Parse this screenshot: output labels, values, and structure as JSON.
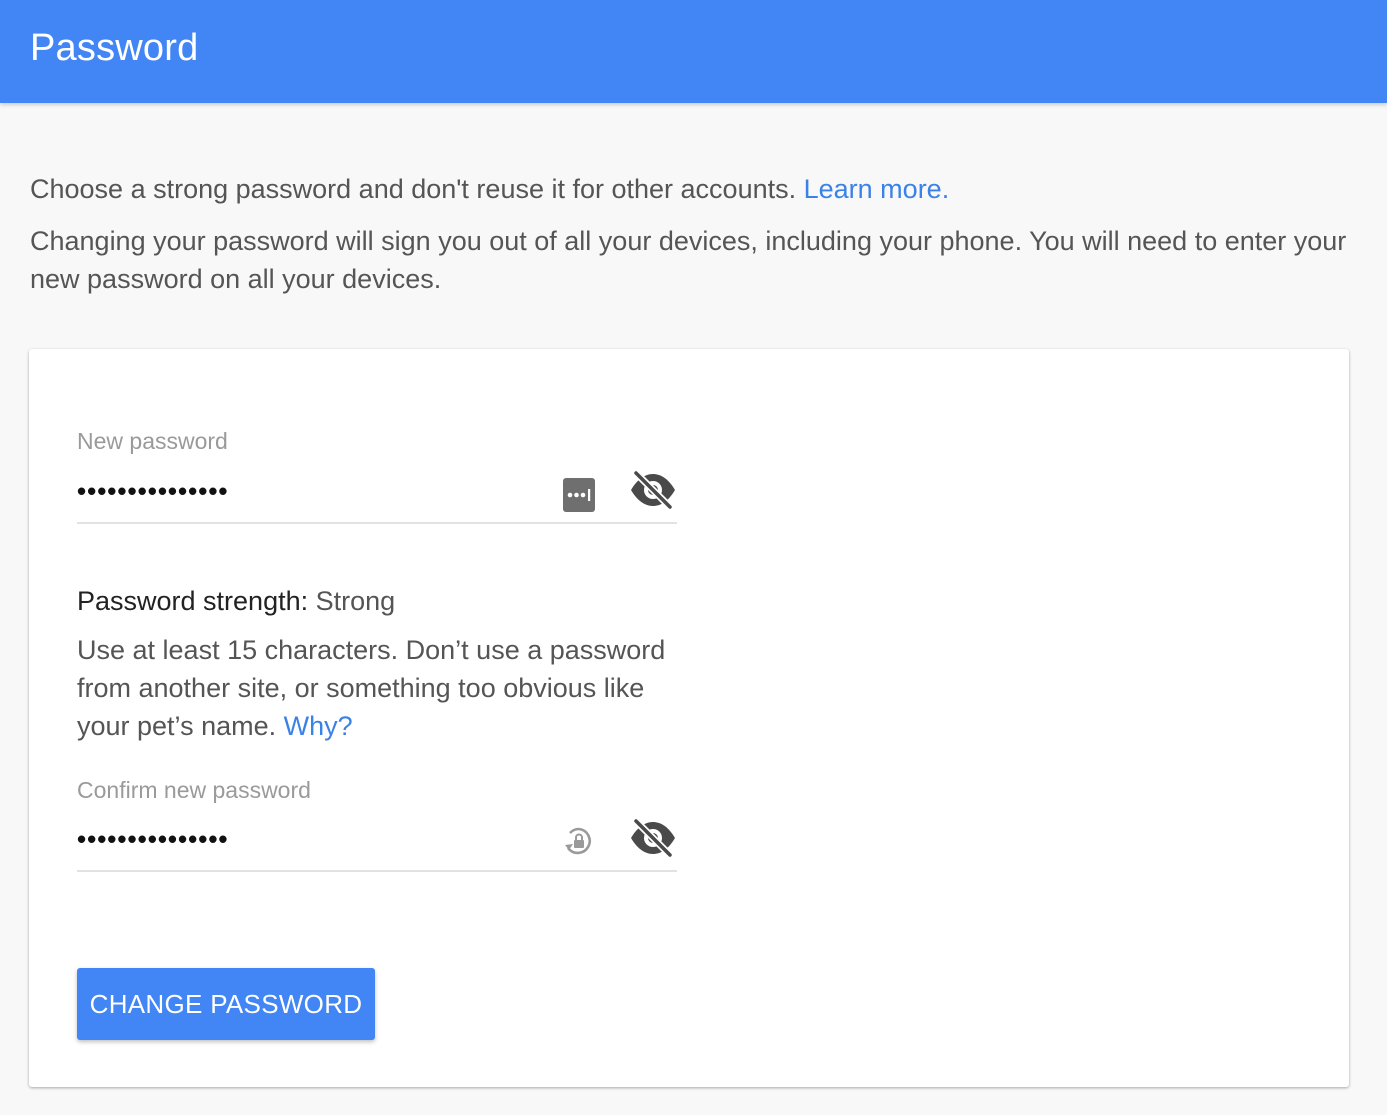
{
  "header": {
    "title": "Password"
  },
  "intro": {
    "line1": "Choose a strong password and don't reuse it for other accounts.",
    "learn_more": "Learn more.",
    "line2": "Changing your password will sign you out of all your devices, including your phone. You will need to enter your new password on all your devices."
  },
  "form": {
    "new_password": {
      "label": "New password",
      "value": "•••••••••••••••",
      "icons": [
        "password-manager-icon",
        "visibility-off-icon"
      ]
    },
    "strength": {
      "label": "Password strength:",
      "value": "Strong"
    },
    "hint": {
      "text": "Use at least 15 characters. Don’t use a password from another site, or something too obvious like your pet’s name.",
      "why": "Why?"
    },
    "confirm_password": {
      "label": "Confirm new password",
      "value": "•••••••••••••••",
      "icons": [
        "lock-sync-icon",
        "visibility-off-icon"
      ]
    },
    "submit_label": "CHANGE PASSWORD"
  },
  "colors": {
    "primary": "#4285f4",
    "link": "#3b82e8",
    "background": "#f8f8f8",
    "card": "#ffffff"
  }
}
